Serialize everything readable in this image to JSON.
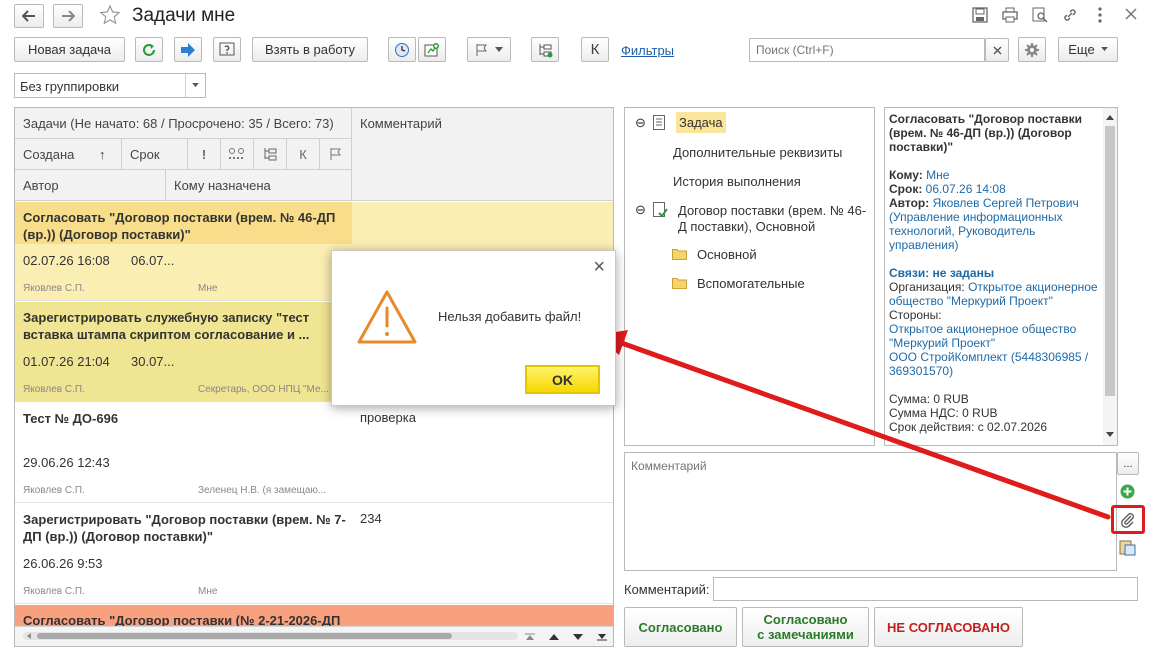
{
  "window": {
    "title": "Задачи мне"
  },
  "toolbar": {
    "new_task": "Новая задача",
    "take_to_work": "Взять в работу",
    "k_label": "К",
    "filters": "Фильтры",
    "search_placeholder": "Поиск (Ctrl+F)",
    "more": "Еще"
  },
  "grouping": {
    "value": "Без группировки"
  },
  "grid": {
    "header_tasks": "Задачи (Не начато: 68 / Просрочено: 35 / Всего: 73)",
    "header_comment": "Комментарий",
    "col_created": "Создана",
    "sort_arrow": "↑",
    "col_due": "Срок",
    "col_excl": "!",
    "col_k": "К",
    "col_author": "Автор",
    "col_assignee": "Кому назначена",
    "rows": [
      {
        "title": "Согласовать \"Договор поставки (врем. № 46-ДП (вр.)) (Договор поставки)\"",
        "created": "02.07.26 16:08",
        "due": "06.07...",
        "author": "Яковлев С.П.",
        "assignee": "Мне",
        "comment": ""
      },
      {
        "title": "Зарегистрировать служебную записку \"тест вставка штампа скриптом согласование и ...",
        "created": "01.07.26 21:04",
        "due": "30.07...",
        "author": "Яковлев С.П.",
        "assignee": "Секретарь, ООО НПЦ \"Ме...",
        "comment": ""
      },
      {
        "title": "Тест № ДО-696",
        "created": "29.06.26 12:43",
        "due": "",
        "author": "Яковлев С.П.",
        "assignee": "Зеленец Н.В. (я замещаю...",
        "comment": "проверка"
      },
      {
        "title": "Зарегистрировать \"Договор поставки (врем. № 7-ДП (вр.)) (Договор поставки)\"",
        "created": "26.06.26 9:53",
        "due": "",
        "author": "Яковлев С.П.",
        "assignee": "Мне",
        "comment": "234"
      },
      {
        "title": "Согласовать \"Договор поставки (№ 2-21-2026-ДП",
        "created": "",
        "due": "",
        "author": "",
        "assignee": "",
        "comment": ""
      }
    ]
  },
  "tree": {
    "task": "Задача",
    "extra": "Дополнительные реквизиты",
    "history": "История выполнения",
    "doc": "Договор поставки (врем. № 46-Д поставки), Основной",
    "main": "Основной",
    "aux": "Вспомогательные"
  },
  "info": {
    "title": "Согласовать \"Договор поставки (врем. № 46-ДП (вр.)) (Договор поставки)\"",
    "to_label": "Кому:",
    "to_value": "Мне",
    "due_label": "Срок:",
    "due_value": "06.07.26 14:08",
    "author_label": "Автор:",
    "author_value": "Яковлев Сергей Петрович (Управление информационных технологий, Руководитель управления)",
    "links_label": "Связи: не заданы",
    "org_label": "Организация:",
    "org_value": "Открытое акционерное общество \"Меркурий Проект\"",
    "parties_label": "Стороны:",
    "party1": "Открытое акционерное общество \"Меркурий Проект\"",
    "party2": "ООО СтройКомплект (5448306985 / 369301570)",
    "sum": "Сумма: 0 RUB",
    "vat": "Сумма НДС: 0 RUB",
    "validity": "Срок действия: с 02.07.2026"
  },
  "comment_area": {
    "placeholder": "Комментарий",
    "label": "Комментарий:",
    "dots": "..."
  },
  "actions": {
    "approved": "Согласовано",
    "approved_remarks_1": "Согласовано",
    "approved_remarks_2": "с замечаниями",
    "not_approved": "НЕ СОГЛАСОВАНО"
  },
  "dialog": {
    "message": "Нельзя добавить файл!",
    "ok": "OK",
    "close": "×"
  },
  "colors": {
    "row_selected": "#fbeeb2",
    "row_yellow": "#efe592",
    "row_red": "#f9a17f",
    "annotation": "#e01b1b",
    "warning": "#e8892a",
    "ok_button": "#f5d800"
  }
}
